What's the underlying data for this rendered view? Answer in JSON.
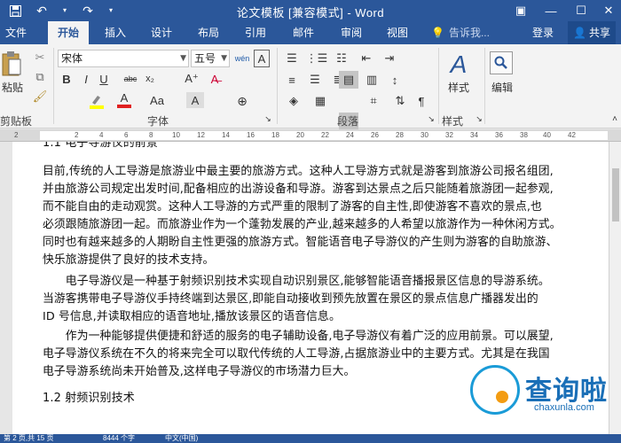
{
  "titlebar": {
    "title": "论文模板 [兼容模式] - Word",
    "save_icon": "save-icon",
    "undo_icon": "undo-icon",
    "redo_icon": "redo-icon",
    "customize_icon": "chevron-down-icon",
    "bg_color": "#2b579a"
  },
  "tabs": [
    "文件",
    "开始",
    "插入",
    "设计",
    "布局",
    "引用",
    "邮件",
    "审阅",
    "视图"
  ],
  "active_tab": "开始",
  "tell_me": "告诉我...",
  "login": "登录",
  "share": "共享",
  "ribbon": {
    "clipboard": {
      "paste": "粘贴",
      "label": "剪贴板"
    },
    "font": {
      "font_name": "宋体",
      "font_size": "五号",
      "wen": "wén",
      "A_large": "A",
      "bold": "B",
      "italic": "I",
      "underline": "U",
      "strike": "abc",
      "sub": "x₂",
      "font_color": "A",
      "case": "Aa",
      "label": "字体"
    },
    "paragraph": {
      "label": "段落"
    },
    "styles": {
      "button": "样式",
      "label": "样式"
    },
    "editing": {
      "button": "编辑"
    }
  },
  "ruler": {
    "ticks": [
      "2",
      "2",
      "4",
      "6",
      "8",
      "10",
      "12",
      "14",
      "16",
      "18",
      "20",
      "22",
      "24",
      "26",
      "28",
      "30",
      "32",
      "34",
      "36",
      "38",
      "40",
      "42"
    ]
  },
  "document": {
    "top_heading": "1.1 电子导游仪的前景",
    "lines": [
      "目前,传统的人工导游是旅游业中最主要的旅游方式。这种人工导游方式就是游客到旅游公司报名组团,",
      "并由旅游公司规定出发时间,配备相应的出游设备和导游。游客到达景点之后只能随着旅游团一起参观,",
      "而不能自由的走动观赏。这种人工导游的方式严重的限制了游客的自主性,即使游客不喜欢的景点,也",
      "必须跟随旅游团一起。而旅游业作为一个蓬勃发展的产业,越来越多的人希望以旅游作为一种休闲方式。",
      "同时也有越来越多的人期盼自主性更强的旅游方式。智能语音电子导游仪的产生则为游客的自助旅游、",
      "快乐旅游提供了良好的技术支持。",
      "　　电子导游仪是一种基于射频识别技术实现自动识别景区,能够智能语音播报景区信息的导游系统。",
      "当游客携带电子导游仪手持终端到达景区,即能自动接收到预先放置在景区的景点信息广播器发出的",
      "ID 号信息,并读取相应的语音地址,播放该景区的语音信息。",
      "　　作为一种能够提供便捷和舒适的服务的电子辅助设备,电子导游仪有着广泛的应用前景。可以展望,",
      "电子导游仪系统在不久的将来完全可以取代传统的人工导游,占据旅游业中的主要方式。尤其是在我国",
      "电子导游系统尚未开始普及,这样电子导游仪的市场潜力巨大。"
    ],
    "section_heading": "1.2 射频识别技术"
  },
  "status": {
    "page": "第 2 页,共 15 页",
    "words": "8444 个字",
    "lang": "中文(中国)"
  },
  "watermark": {
    "brand": "查询啦",
    "url": "chaxunla.com"
  },
  "colors": {
    "accent": "#2b579a",
    "highlight": "#ffff00",
    "font_red": "#e02020"
  }
}
